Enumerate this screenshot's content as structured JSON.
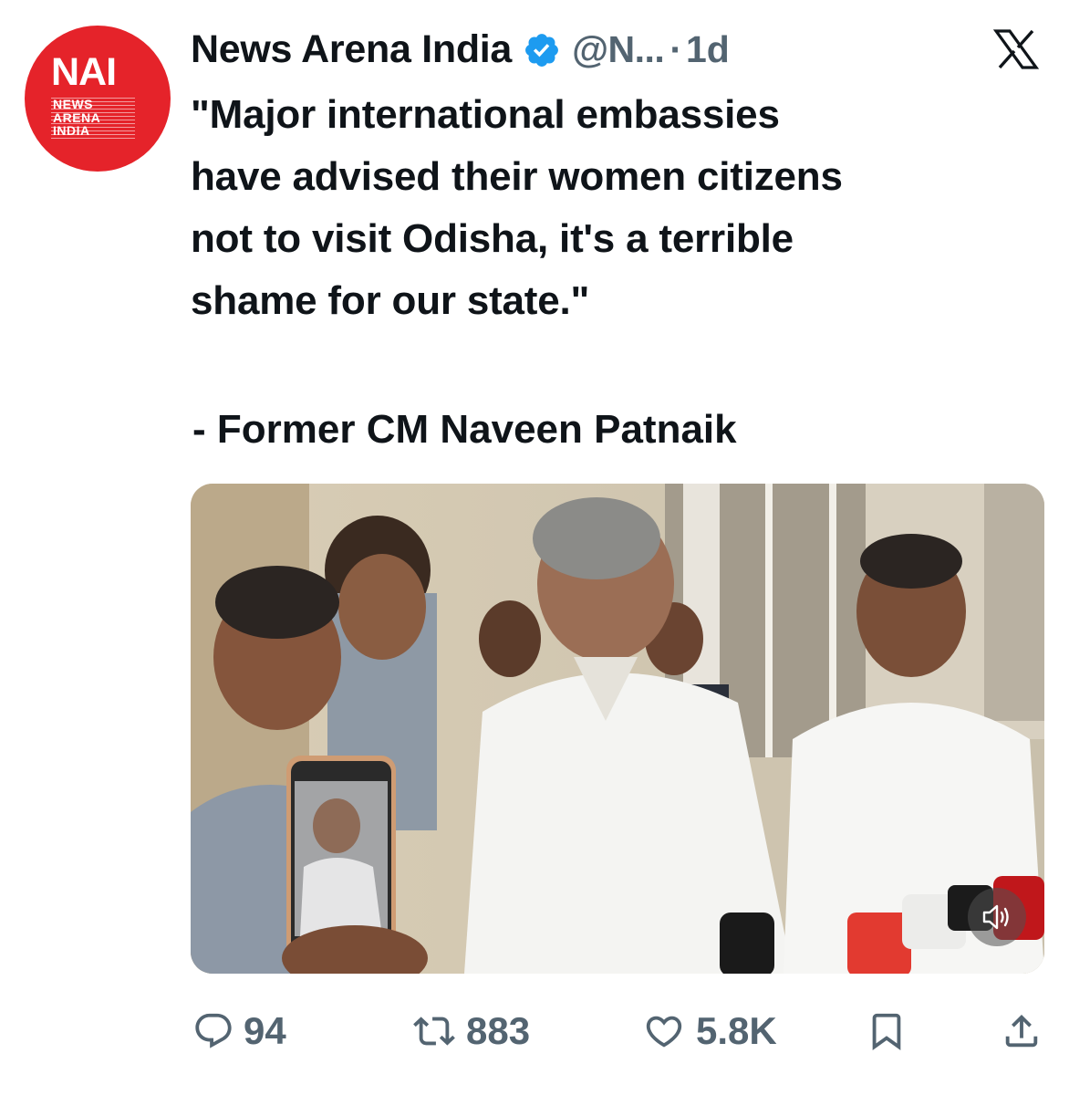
{
  "author": {
    "display_name": "News Arena India",
    "handle": "@N...",
    "separator": "·",
    "time": "1d",
    "avatar": {
      "logo_main": "NAI",
      "logo_lines": [
        "NEWS",
        "ARENA",
        "INDIA"
      ],
      "color": "#e5232a"
    },
    "verified_color": "#1d9bf0"
  },
  "platform_icon": "x-logo-icon",
  "tweet": {
    "quote_lines": [
      "\"Major international embassies",
      "have advised their women citizens",
      "not to visit Odisha, it's a terrible",
      "shame for our state.\""
    ],
    "attribution": "- Former CM Naveen Patnaik"
  },
  "media": {
    "type": "video",
    "icon": "volume-icon"
  },
  "actions": {
    "replies": "94",
    "reposts": "883",
    "likes": "5.8K",
    "icons": [
      "reply-icon",
      "repost-icon",
      "like-icon",
      "bookmark-icon",
      "share-icon"
    ]
  },
  "colors": {
    "text": "#0f1419",
    "secondary": "#536471"
  }
}
